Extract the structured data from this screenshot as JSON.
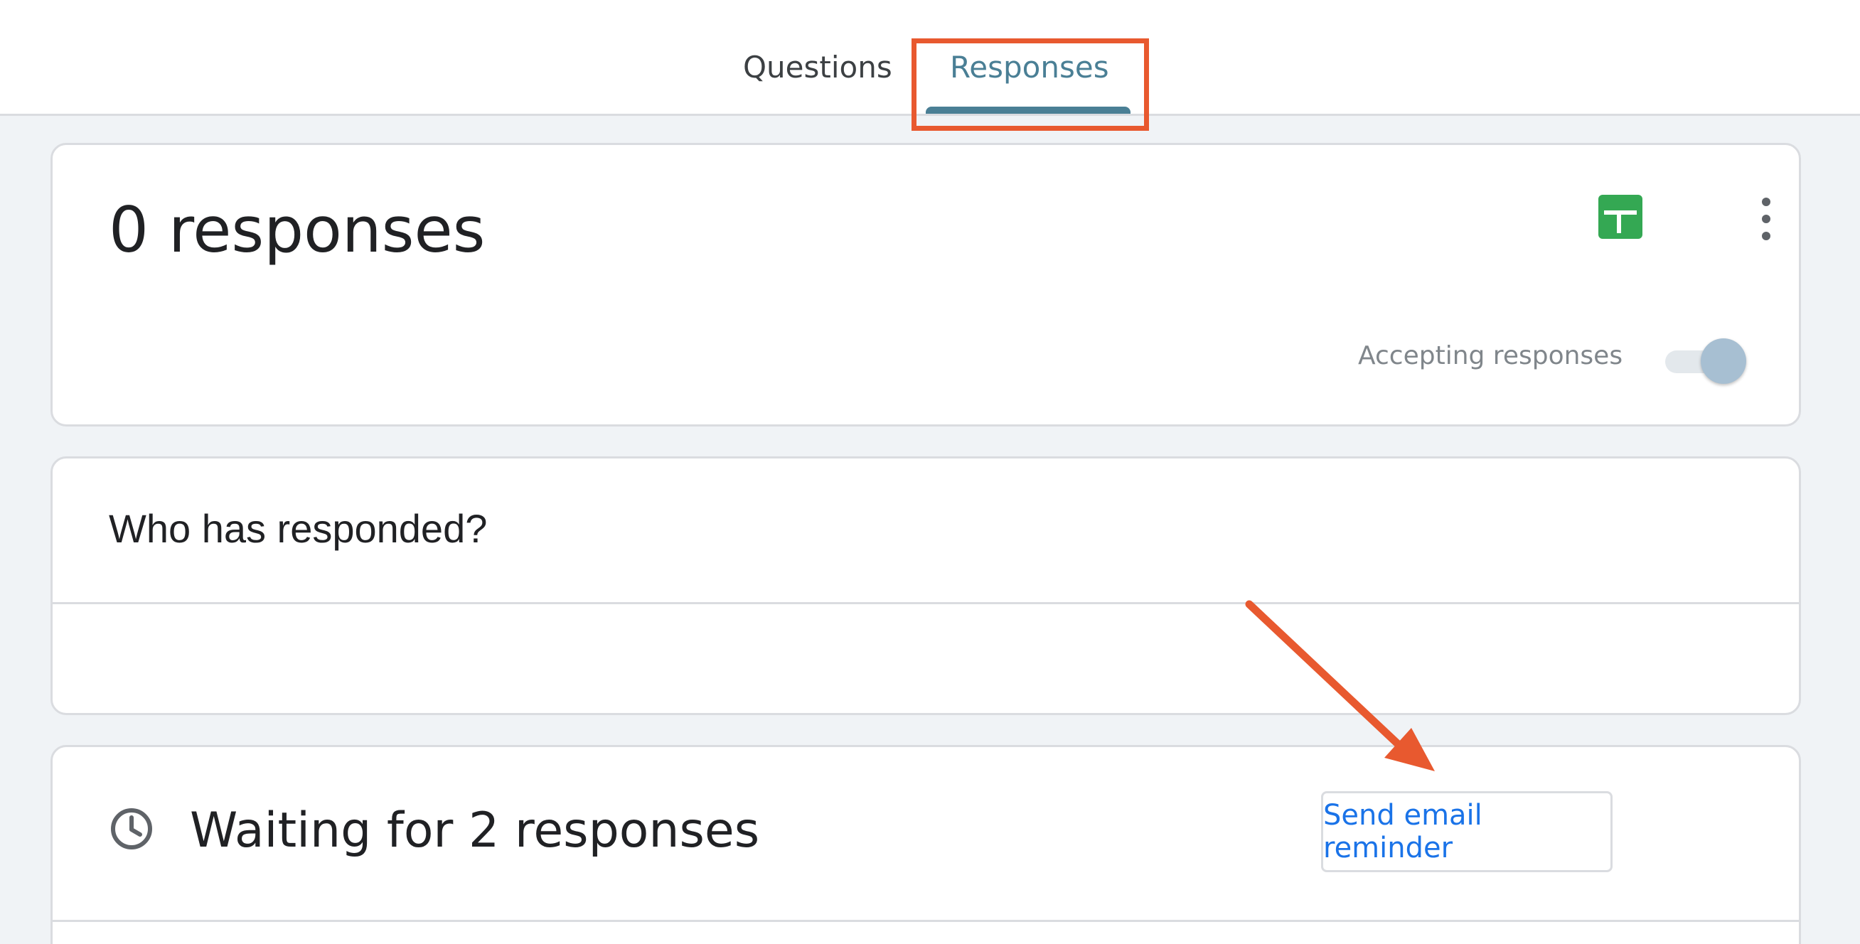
{
  "tabs": {
    "questions_label": "Questions",
    "responses_label": "Responses",
    "active": "Responses"
  },
  "summary": {
    "count_text": "0 responses",
    "sheets_icon": "google-sheets-icon",
    "more_icon": "more-vert-icon",
    "accepting_label": "Accepting responses",
    "accepting_enabled": true
  },
  "who": {
    "title": "Who has responded?"
  },
  "waiting": {
    "icon": "clock-icon",
    "title": "Waiting for 2 responses",
    "reminder_button_label": "Send email reminder"
  },
  "colors": {
    "annotation": "#e8592f",
    "active_tab": "#4a7f95",
    "sheets_green": "#34a853",
    "link_blue": "#1a73e8"
  }
}
